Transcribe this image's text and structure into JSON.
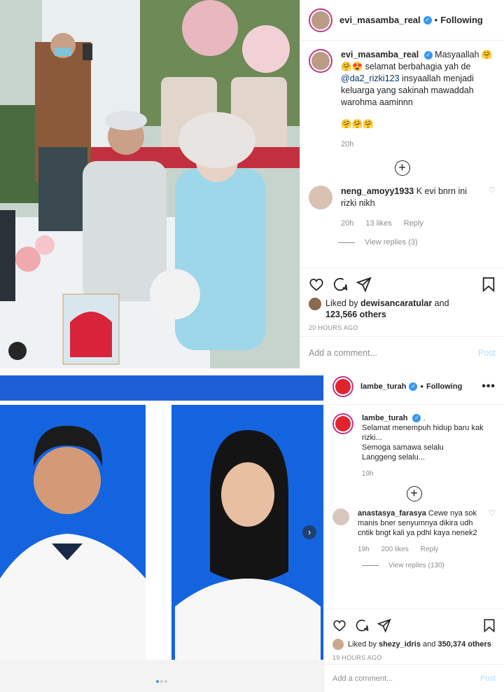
{
  "post1": {
    "username": "evi_masamba_real",
    "following_label": "Following",
    "more_label": "•••",
    "caption": {
      "username": "evi_masamba_real",
      "text_a": "Masyaallah 🤗🤗😍 selamat berbahagia yah de ",
      "mention": "@da2_rizki123",
      "text_b": " insyaallah menjadi keluarga yang sakinah mawaddah warohma aaminnn",
      "text_c": "🤗🤗🤗",
      "time": "20h"
    },
    "comment": {
      "username": "neng_amoyy1933",
      "text": "K evi bnrn ini rizki nikh",
      "time": "20h",
      "likes": "13 likes",
      "reply": "Reply",
      "view_replies": "View replies (3)"
    },
    "liked_by_prefix": "Liked by",
    "liked_by_user": "dewisancaratular",
    "liked_and": "and",
    "liked_others": "123,566 others",
    "timestamp": "20 HOURS AGO",
    "add_comment_placeholder": "Add a comment...",
    "post_label": "Post"
  },
  "post2": {
    "username": "lambe_turah",
    "following_label": "Following",
    "more_label": "•••",
    "caption": {
      "username": "lambe_turah",
      "text_a": " .",
      "line1": "Selamat menempuh hidup baru kak rizki...",
      "line2": "Semoga samawa selalu",
      "line3": "Langgeng selalu...",
      "time": "19h"
    },
    "comment": {
      "username": "anastasya_farasya",
      "text": "Cewe nya sok manis bner senyumnya dikira udh cntik bngt kali ya pdhl kaya nenek2",
      "time": "19h",
      "likes": "200 likes",
      "reply": "Reply",
      "view_replies": "View replies (130)"
    },
    "liked_by_prefix": "Liked by",
    "liked_by_user": "shezy_idris",
    "liked_and": "and",
    "liked_others": "350,374 others",
    "timestamp": "19 HOURS AGO",
    "add_comment_placeholder": "Add a comment...",
    "post_label": "Post"
  },
  "colors": {
    "accent_blue": "#3897f0",
    "photo_blue": "#1e5fd6",
    "muted": "#8e8e8e"
  }
}
